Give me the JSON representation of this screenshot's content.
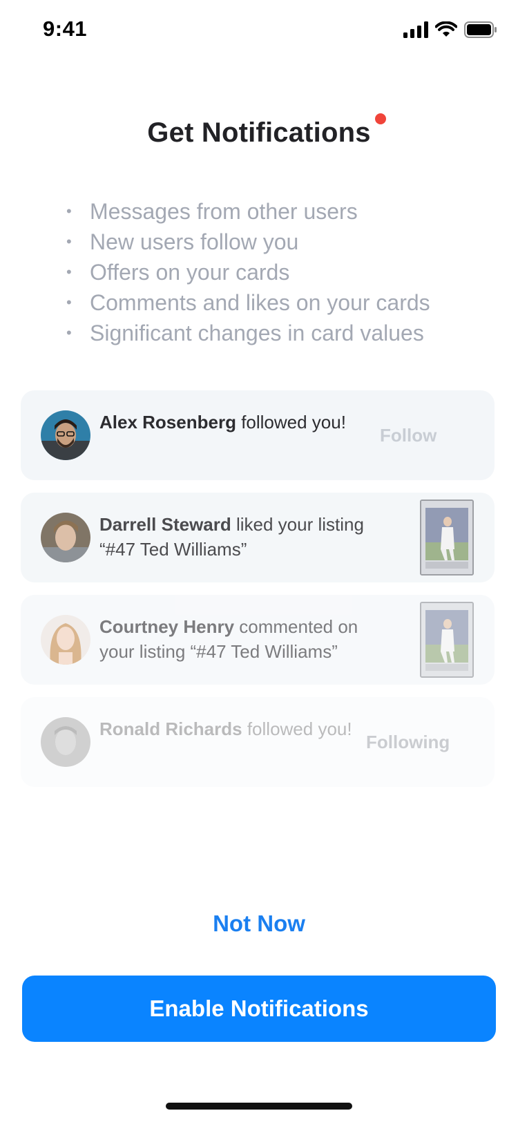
{
  "status_bar": {
    "time": "9:41",
    "icons": [
      "cellular-signal-icon",
      "wifi-icon",
      "battery-icon"
    ]
  },
  "title": "Get Notifications",
  "benefits": [
    "Messages from other users",
    "New users follow you",
    "Offers on your cards",
    "Comments and likes on your cards",
    "Significant changes in card values"
  ],
  "bullet": "•",
  "notifications": [
    {
      "name": "Alex Rosenberg",
      "text": "followed you!",
      "action": "Follow"
    },
    {
      "name": "Darrell Steward",
      "text": "liked your listing “#47 Ted Williams”"
    },
    {
      "name": "Courtney Henry",
      "text": "commented on your listing “#47 Ted Williams”"
    },
    {
      "name": "Ronald Richards",
      "text": "followed you!",
      "action": "Following"
    }
  ],
  "buttons": {
    "not_now": "Not Now",
    "enable": "Enable Notifications"
  },
  "colors": {
    "accent": "#0a84ff",
    "title_dot": "#f0443a",
    "card_background": "#f3f6f9",
    "muted_text": "#a3a8b3"
  }
}
